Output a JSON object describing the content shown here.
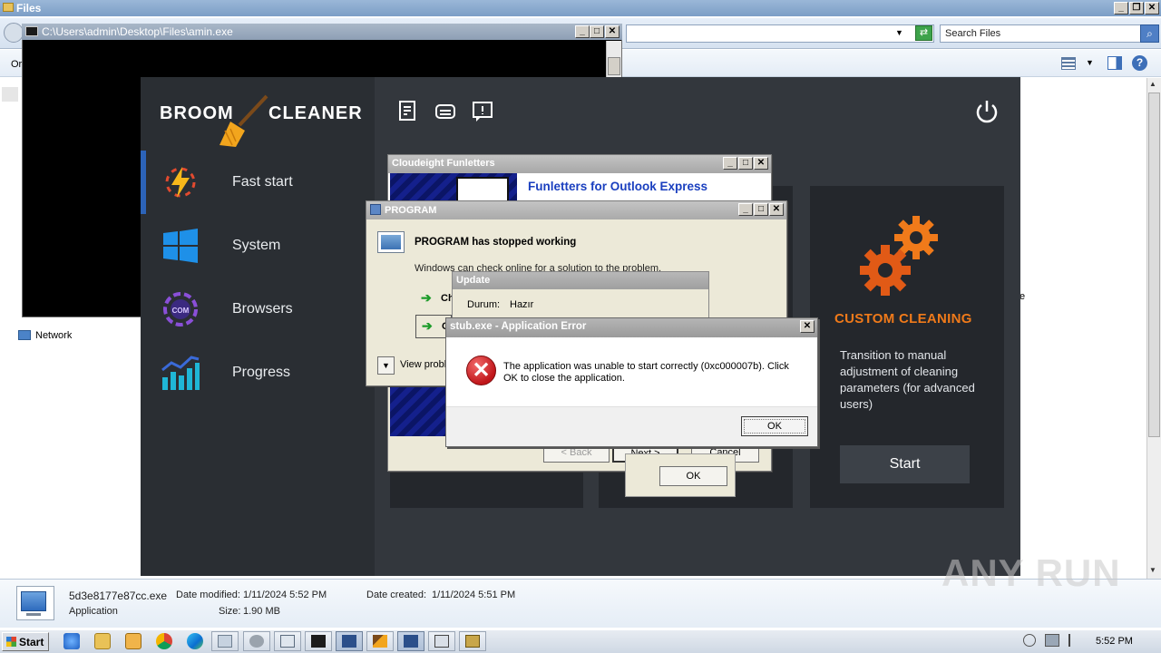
{
  "explorer": {
    "title": "Files",
    "search_placeholder": "Search Files",
    "organize_label": "Or",
    "network_label": "Network",
    "side_text": "e",
    "details": {
      "filename": "5d3e8177e87cc.exe",
      "date_modified_label": "Date modified:",
      "date_modified": "1/11/2024 5:52 PM",
      "date_created_label": "Date created:",
      "date_created": "1/11/2024 5:51 PM",
      "type": "Application",
      "size_label": "Size:",
      "size": "1.90 MB"
    }
  },
  "console": {
    "title": "C:\\Users\\admin\\Desktop\\Files\\amin.exe"
  },
  "broom": {
    "brand_left": "BROOM",
    "brand_right": "CLEANER",
    "sidebar": [
      {
        "label": "Fast start",
        "icon": "lightning-icon"
      },
      {
        "label": "System",
        "icon": "windows-icon"
      },
      {
        "label": "Browsers",
        "icon": "browser-globe-icon"
      },
      {
        "label": "Progress",
        "icon": "progress-bars-icon"
      }
    ],
    "custom_card": {
      "title": "CUSTOM CLEANING",
      "description": "Transition to manual adjustment of cleaning parameters (for advanced users)",
      "start_label": "Start"
    },
    "accent_color": "#f07a1a"
  },
  "cloudeight": {
    "title": "Cloudeight Funletters",
    "header": "Funletters for Outlook Express",
    "back_label": "< Back",
    "next_label": "Next >",
    "cancel_label": "Cancel"
  },
  "program_error": {
    "title": "PROGRAM",
    "heading": "PROGRAM has stopped working",
    "subtext": "Windows can check online for a solution to the problem.",
    "option1": "Ch",
    "option2": "C",
    "view_problem": "View probl",
    "ok_label": "OK"
  },
  "update": {
    "title": "Update",
    "status_label": "Durum:",
    "status_value": "Hazır"
  },
  "stub_error": {
    "title": "stub.exe - Application Error",
    "message": "The application was unable to start correctly (0xc000007b). Click OK to close the application.",
    "ok_label": "OK"
  },
  "taskbar": {
    "start_label": "Start",
    "clock": "5:52 PM"
  },
  "watermark": "ANY RUN"
}
